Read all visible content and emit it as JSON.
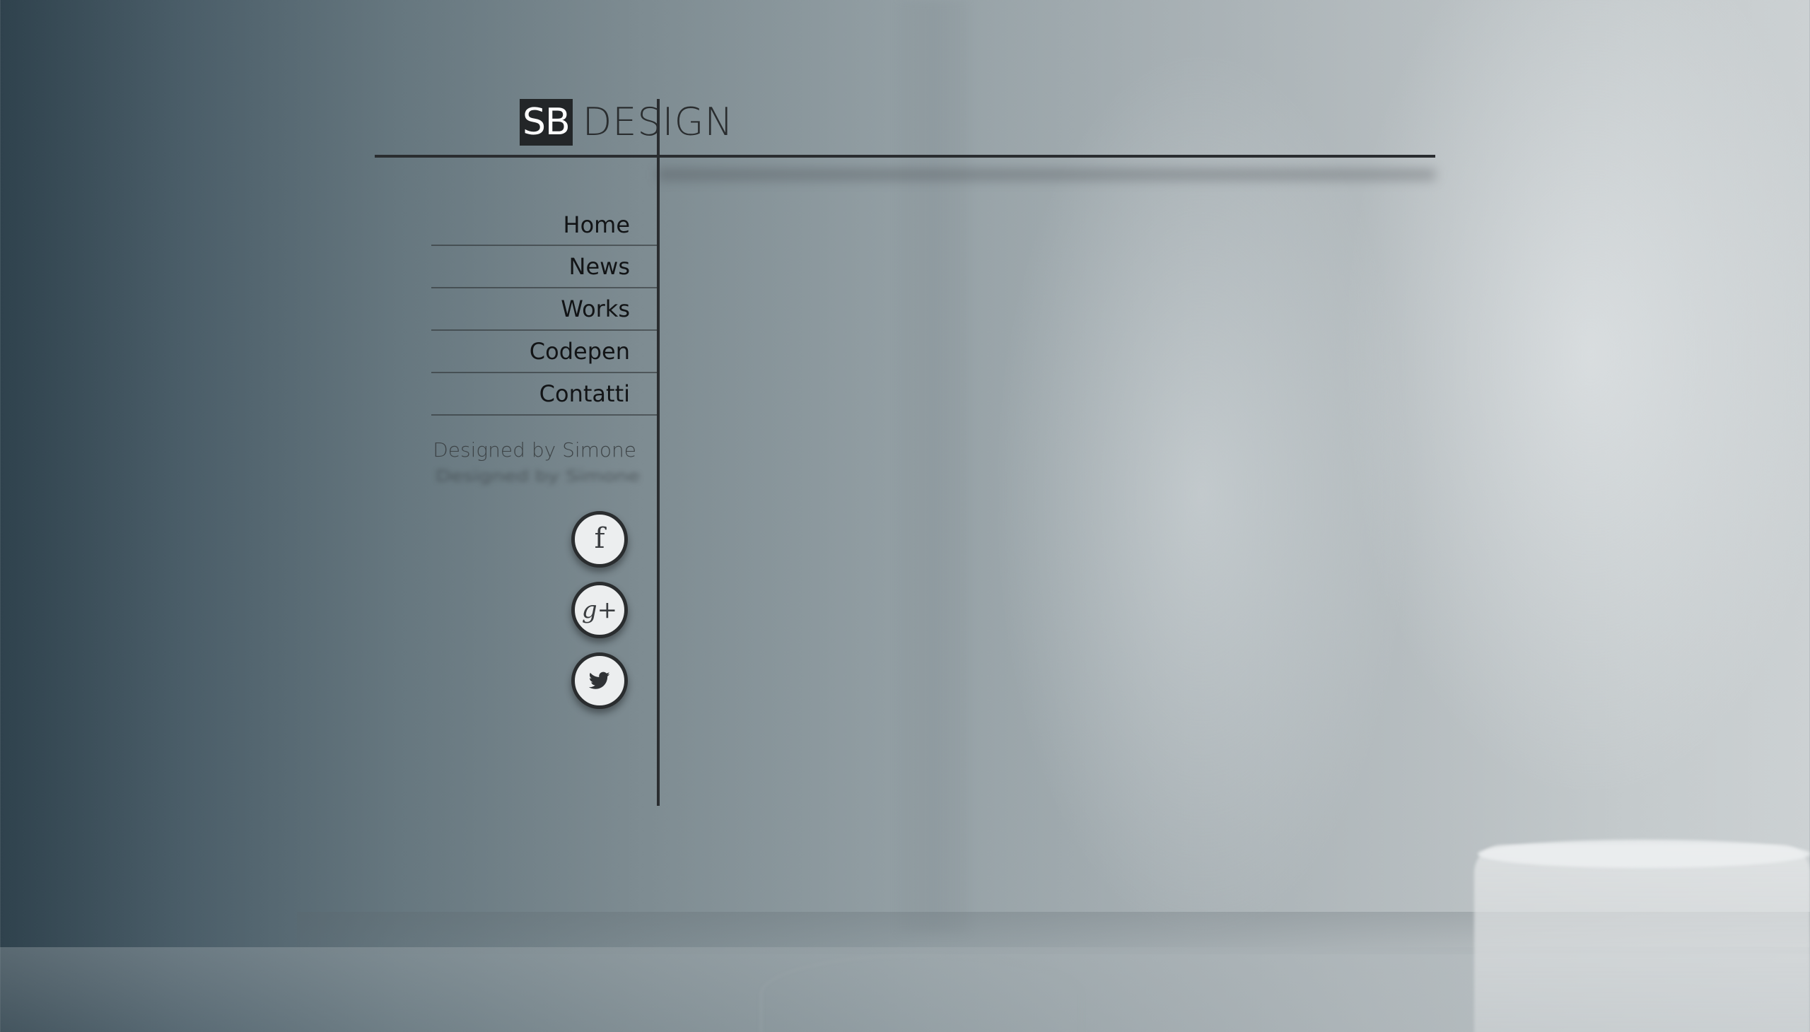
{
  "header": {
    "logo_mark": "SB",
    "logo_text": "DESIGN"
  },
  "nav": {
    "items": [
      {
        "label": "Home"
      },
      {
        "label": "News"
      },
      {
        "label": "Works"
      },
      {
        "label": "Codepen"
      },
      {
        "label": "Contatti"
      }
    ]
  },
  "footer": {
    "credit": "Designed by Simone"
  },
  "social": {
    "facebook": {
      "icon": "facebook-icon",
      "glyph": "f"
    },
    "googleplus": {
      "icon": "google-plus-icon",
      "glyph": "g+"
    },
    "twitter": {
      "icon": "twitter-icon"
    }
  },
  "colors": {
    "line": "#2a2d30",
    "logo_box": "#232628",
    "button_bg": "#eceeef"
  }
}
